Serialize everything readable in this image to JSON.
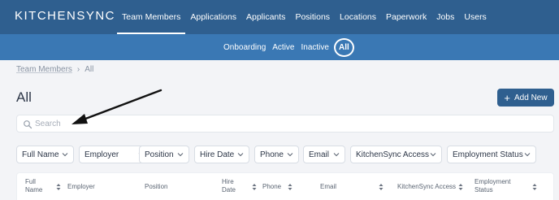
{
  "app": {
    "logo": "KITCHENSYNC"
  },
  "main_nav": {
    "items": [
      {
        "label": "Team Members",
        "active": true
      },
      {
        "label": "Applications",
        "active": false
      },
      {
        "label": "Applicants",
        "active": false
      },
      {
        "label": "Positions",
        "active": false
      },
      {
        "label": "Locations",
        "active": false
      },
      {
        "label": "Paperwork",
        "active": false
      },
      {
        "label": "Jobs",
        "active": false
      },
      {
        "label": "Users",
        "active": false
      }
    ]
  },
  "sub_nav": {
    "items": [
      {
        "label": "Onboarding",
        "active": false
      },
      {
        "label": "Active",
        "active": false
      },
      {
        "label": "Inactive",
        "active": false
      },
      {
        "label": "All",
        "active": true
      }
    ]
  },
  "breadcrumb": {
    "parent": "Team Members",
    "separator": "›",
    "current": "All"
  },
  "page": {
    "title": "All",
    "add_button_label": "Add New"
  },
  "search": {
    "placeholder": "Search",
    "value": ""
  },
  "filters": [
    {
      "label": "Full Name"
    },
    {
      "label": "Employer"
    },
    {
      "label": "Position"
    },
    {
      "label": "Hire Date"
    },
    {
      "label": "Phone"
    },
    {
      "label": "Email"
    },
    {
      "label": "KitchenSync Access"
    },
    {
      "label": "Employment Status"
    }
  ],
  "table": {
    "columns": [
      {
        "line1": "Full",
        "line2": "Name"
      },
      {
        "line1": "Employer",
        "line2": ""
      },
      {
        "line1": "Position",
        "line2": ""
      },
      {
        "line1": "Hire",
        "line2": "Date"
      },
      {
        "line1": "Phone",
        "line2": ""
      },
      {
        "line1": "Email",
        "line2": ""
      },
      {
        "line1": "KitchenSync Access",
        "line2": ""
      },
      {
        "line1": "Employment",
        "line2": "Status"
      }
    ]
  },
  "colors": {
    "topbar": "#2f5f8f",
    "subbar": "#3a78b4",
    "accent_button": "#2f5f8f",
    "page_background": "#f3f4f7"
  },
  "icons": [
    "search-icon",
    "plus-icon",
    "chevron-down-icon",
    "sort-icon",
    "arrow-annotation"
  ]
}
